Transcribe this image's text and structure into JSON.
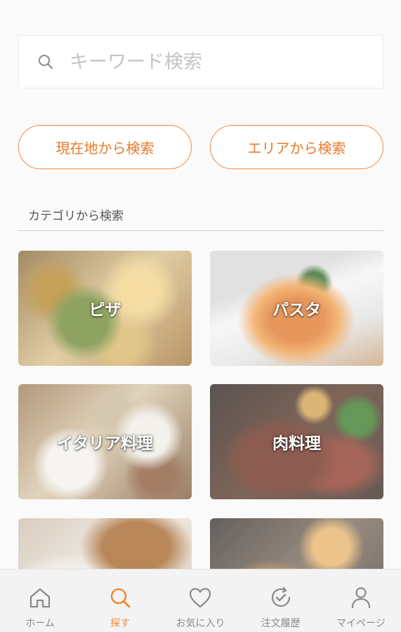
{
  "search": {
    "placeholder": "キーワード検索"
  },
  "buttons": {
    "current_location": "現在地から検索",
    "area": "エリアから検索"
  },
  "section_title": "カテゴリから検索",
  "categories": [
    {
      "label": "ピザ"
    },
    {
      "label": "パスタ"
    },
    {
      "label": "イタリア料理"
    },
    {
      "label": "肉料理"
    },
    {
      "label": ""
    },
    {
      "label": ""
    }
  ],
  "tabbar": {
    "items": [
      {
        "label": "ホーム",
        "icon": "home-icon"
      },
      {
        "label": "探す",
        "icon": "search-icon",
        "active": true
      },
      {
        "label": "お気に入り",
        "icon": "heart-icon"
      },
      {
        "label": "注文履歴",
        "icon": "history-icon"
      },
      {
        "label": "マイページ",
        "icon": "user-icon"
      }
    ]
  },
  "colors": {
    "accent": "#ef8a3c",
    "inactive": "#8a8a8a"
  }
}
